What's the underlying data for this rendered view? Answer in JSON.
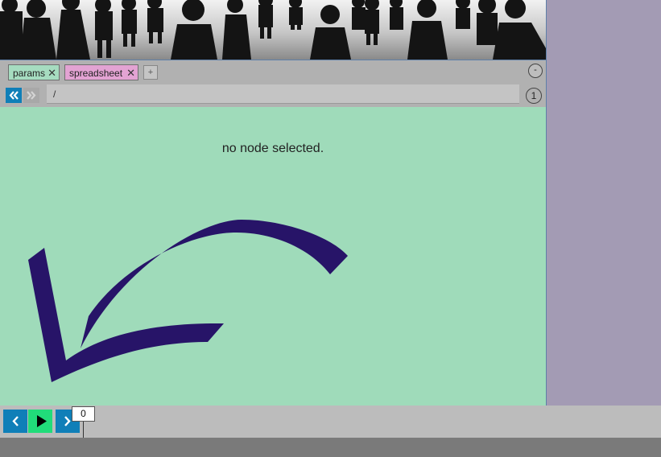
{
  "colors": {
    "accent_blue": "#0f7fb8",
    "play_green": "#21dc7a",
    "content_bg": "#9fdbba",
    "tab_params_bg": "#a6dcc0",
    "tab_spreadsheet_bg": "#e3a3d3",
    "side_panel_bg": "#a39bb4",
    "arrow": "#271468"
  },
  "tabs": [
    {
      "label": "params",
      "close": "✕"
    },
    {
      "label": "spreadsheet",
      "close": "✕"
    }
  ],
  "tab_add_label": "+",
  "collapse_label": "-",
  "path": {
    "value": "/"
  },
  "node_count": "1",
  "content": {
    "empty_message": "no node selected."
  },
  "timeline": {
    "current_frame": "0"
  },
  "icons": {
    "back": "double-chevron-left-icon",
    "forward": "double-chevron-right-icon",
    "prev": "chevron-left-icon",
    "play": "play-icon",
    "next": "chevron-right-icon",
    "arrow": "curved-arrow-icon"
  }
}
